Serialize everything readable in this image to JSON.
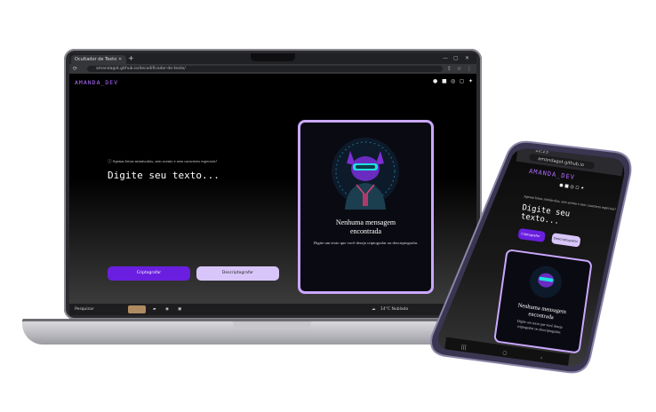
{
  "browser": {
    "tab_title": "Ocultador de Texto",
    "tab_close": "✕",
    "new_tab": "+",
    "url": "amandagot.github.io/decodificador-de-texto/",
    "win_minimize": "—",
    "win_maximize": "▢",
    "win_close": "✕"
  },
  "site": {
    "logo": "AMANDA_DEV",
    "info": "Apenas letras minúsculas, sem acento e sem caracteres especiais!",
    "headline": "Digite seu texto...",
    "encrypt_label": "Criptografar",
    "decrypt_label": "Descriptografar",
    "card_title_line1": "Nenhuma mensagem",
    "card_title_line2": "encontrada",
    "card_text": "Digite um texto que você deseja criptografar ou descriptografar."
  },
  "taskbar": {
    "search_label": "Pesquisar",
    "weather": "14°C  Nublado"
  },
  "phone": {
    "time": "22:23",
    "url": "amandagot.github.io",
    "logo": "AMANDA_DEV",
    "info": "Apenas letras minúsculas, sem acento e sem caracteres especiais!",
    "headline_line1": "Digite seu",
    "headline_line2": "texto...",
    "encrypt_label": "Criptografar",
    "decrypt_label": "Descriptografar",
    "card_title_line1": "Nenhuma mensagem",
    "card_title_line2": "encontrada",
    "card_text_line1": "Digite um texto que você deseja",
    "card_text_line2": "criptografar ou descriptografar."
  },
  "colors": {
    "accent": "#6a1fe0",
    "accent_light": "#d8c6fb",
    "card_border": "#caa8ff",
    "logo": "#b06cff"
  }
}
